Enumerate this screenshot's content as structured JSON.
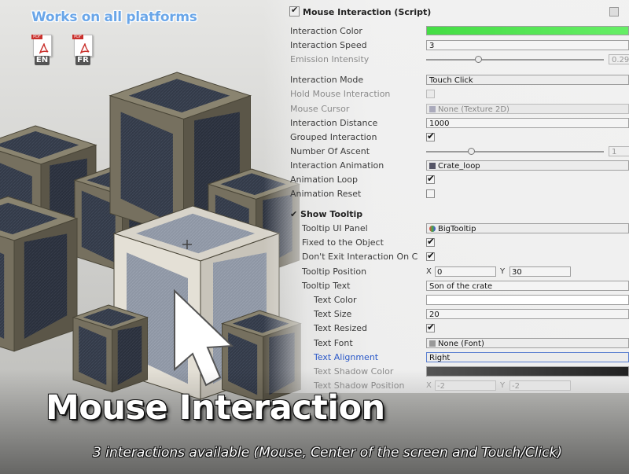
{
  "banner": {
    "platforms": "Works on all platforms"
  },
  "pdf_docs": [
    {
      "tag": "PDF",
      "lang": "EN"
    },
    {
      "tag": "PDF",
      "lang": "FR"
    }
  ],
  "inspector": {
    "component_title": "Mouse Interaction (Script)",
    "interaction_color": {
      "label": "Interaction Color",
      "color": "#44dd44"
    },
    "interaction_speed": {
      "label": "Interaction Speed",
      "value": "3"
    },
    "emission_intensity": {
      "label": "Emission Intensity",
      "value": "0.29",
      "level": 0.29
    },
    "interaction_mode": {
      "label": "Interaction Mode",
      "value": "Touch Click"
    },
    "hold_mouse_interaction": {
      "label": "Hold Mouse Interaction",
      "checked": false
    },
    "mouse_cursor": {
      "label": "Mouse Cursor",
      "value": "None (Texture 2D)"
    },
    "interaction_distance": {
      "label": "Interaction Distance",
      "value": "1000"
    },
    "grouped_interaction": {
      "label": "Grouped Interaction",
      "checked": true
    },
    "number_of_ascent": {
      "label": "Number Of Ascent",
      "value": "1",
      "level": 0.25
    },
    "interaction_animation": {
      "label": "Interaction Animation",
      "value": "Crate_loop"
    },
    "animation_loop": {
      "label": "Animation Loop",
      "checked": true
    },
    "animation_reset": {
      "label": "Animation Reset",
      "checked": false
    },
    "show_tooltip": {
      "label": "Show Tooltip",
      "checked": true
    },
    "tooltip_ui_panel": {
      "label": "Tooltip UI Panel",
      "value": "BigTooltip"
    },
    "fixed_to_object": {
      "label": "Fixed to the Object",
      "checked": true
    },
    "dont_exit": {
      "label": "Don't Exit Interaction On C",
      "checked": true
    },
    "tooltip_position": {
      "label": "Tooltip Position",
      "x_label": "X",
      "x": "0",
      "y_label": "Y",
      "y": "30"
    },
    "tooltip_text": {
      "label": "Tooltip Text",
      "value": "Son of the crate"
    },
    "text_color": {
      "label": "Text Color",
      "color": "#ffffff"
    },
    "text_size": {
      "label": "Text Size",
      "value": "20"
    },
    "text_resized": {
      "label": "Text Resized",
      "checked": true
    },
    "text_font": {
      "label": "Text Font",
      "value": "None (Font)"
    },
    "text_alignment": {
      "label": "Text Alignment",
      "value": "Right"
    },
    "text_shadow_color": {
      "label": "Text Shadow Color",
      "color": "#222222"
    },
    "text_shadow_position": {
      "label": "Text Shadow Position",
      "x_label": "X",
      "x": "-2",
      "y_label": "Y",
      "y": "-2"
    }
  },
  "hero": {
    "title": "Mouse Interaction",
    "subtitle": "3 interactions available (Mouse, Center of the screen and Touch/Click)"
  },
  "icons": [
    "pdf-icon",
    "checkbox-icon",
    "gear-icon",
    "texture-icon",
    "animation-clip-icon",
    "prefab-icon",
    "font-icon",
    "mouse-cursor-icon"
  ]
}
